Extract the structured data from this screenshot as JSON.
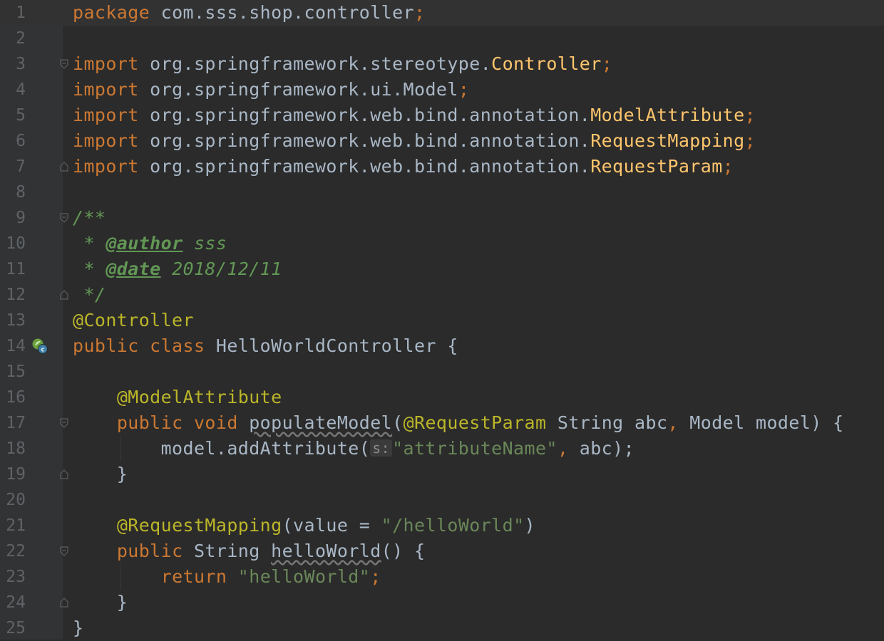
{
  "editor": {
    "language": "Java",
    "current_line": 1,
    "lines": [
      {
        "n": "1",
        "text": "package com.sss.shop.controller;"
      },
      {
        "n": "2",
        "text": ""
      },
      {
        "n": "3",
        "text": "import org.springframework.stereotype.Controller;"
      },
      {
        "n": "4",
        "text": "import org.springframework.ui.Model;"
      },
      {
        "n": "5",
        "text": "import org.springframework.web.bind.annotation.ModelAttribute;"
      },
      {
        "n": "6",
        "text": "import org.springframework.web.bind.annotation.RequestMapping;"
      },
      {
        "n": "7",
        "text": "import org.springframework.web.bind.annotation.RequestParam;"
      },
      {
        "n": "8",
        "text": ""
      },
      {
        "n": "9",
        "text": "/**"
      },
      {
        "n": "10",
        "text": " * @author sss"
      },
      {
        "n": "11",
        "text": " * @date 2018/12/11"
      },
      {
        "n": "12",
        "text": " */"
      },
      {
        "n": "13",
        "text": "@Controller"
      },
      {
        "n": "14",
        "text": "public class HelloWorldController {"
      },
      {
        "n": "15",
        "text": ""
      },
      {
        "n": "16",
        "text": "    @ModelAttribute"
      },
      {
        "n": "17",
        "text": "    public void populateModel(@RequestParam String abc, Model model) {"
      },
      {
        "n": "18",
        "text": "        model.addAttribute(s:\"attributeName\", abc);"
      },
      {
        "n": "19",
        "text": "    }"
      },
      {
        "n": "20",
        "text": ""
      },
      {
        "n": "21",
        "text": "    @RequestMapping(value = \"/helloWorld\")"
      },
      {
        "n": "22",
        "text": "    public String helloWorld() {"
      },
      {
        "n": "23",
        "text": "        return \"helloWorld\";"
      },
      {
        "n": "24",
        "text": "    }"
      },
      {
        "n": "25",
        "text": "}"
      }
    ],
    "tokens": {
      "l1": [
        "package",
        " com.sss.shop.controller",
        ";"
      ],
      "l3": [
        "import",
        " org.springframework.stereotype.",
        "Controller",
        ";"
      ],
      "l4": [
        "import",
        " org.springframework.ui.Model",
        ";"
      ],
      "l5": [
        "import",
        " org.springframework.web.bind.annotation.",
        "ModelAttribute",
        ";"
      ],
      "l6": [
        "import",
        " org.springframework.web.bind.annotation.",
        "RequestMapping",
        ";"
      ],
      "l7": [
        "import",
        " org.springframework.web.bind.annotation.",
        "RequestParam",
        ";"
      ],
      "l9": [
        "/**"
      ],
      "l10": [
        " * ",
        "@author",
        " sss"
      ],
      "l11": [
        " * ",
        "@date",
        " 2018/12/11"
      ],
      "l12": [
        " */"
      ],
      "l13": [
        "@Controller"
      ],
      "l14": [
        "public class",
        " HelloWorldController {"
      ],
      "l16": [
        "    ",
        "@ModelAttribute"
      ],
      "l17": [
        "    ",
        "public void",
        " ",
        "populateModel",
        "(",
        "@RequestParam",
        " String abc",
        ",",
        " Model model) {"
      ],
      "l18": [
        "        model.addAttribute(",
        "s:",
        "\"attributeName\"",
        ",",
        " abc);"
      ],
      "l19": [
        "    }"
      ],
      "l21": [
        "    ",
        "@RequestMapping",
        "(value = ",
        "\"/helloWorld\"",
        ")"
      ],
      "l22": [
        "    ",
        "public",
        " String ",
        "helloWorld",
        "() {"
      ],
      "l23": [
        "        ",
        "return",
        " ",
        "\"helloWorld\"",
        ";"
      ],
      "l24": [
        "    }"
      ],
      "l25": [
        "}"
      ]
    },
    "gutter_icon": "spring-bean-icon",
    "colors": {
      "background": "#2b2b2b",
      "gutter": "#313335",
      "line_number": "#606366",
      "keyword": "#cc7832",
      "annotation": "#bbb529",
      "class_ref": "#ffc66d",
      "string": "#6a8759",
      "doc_comment": "#629755",
      "text": "#a9b7c6"
    }
  }
}
